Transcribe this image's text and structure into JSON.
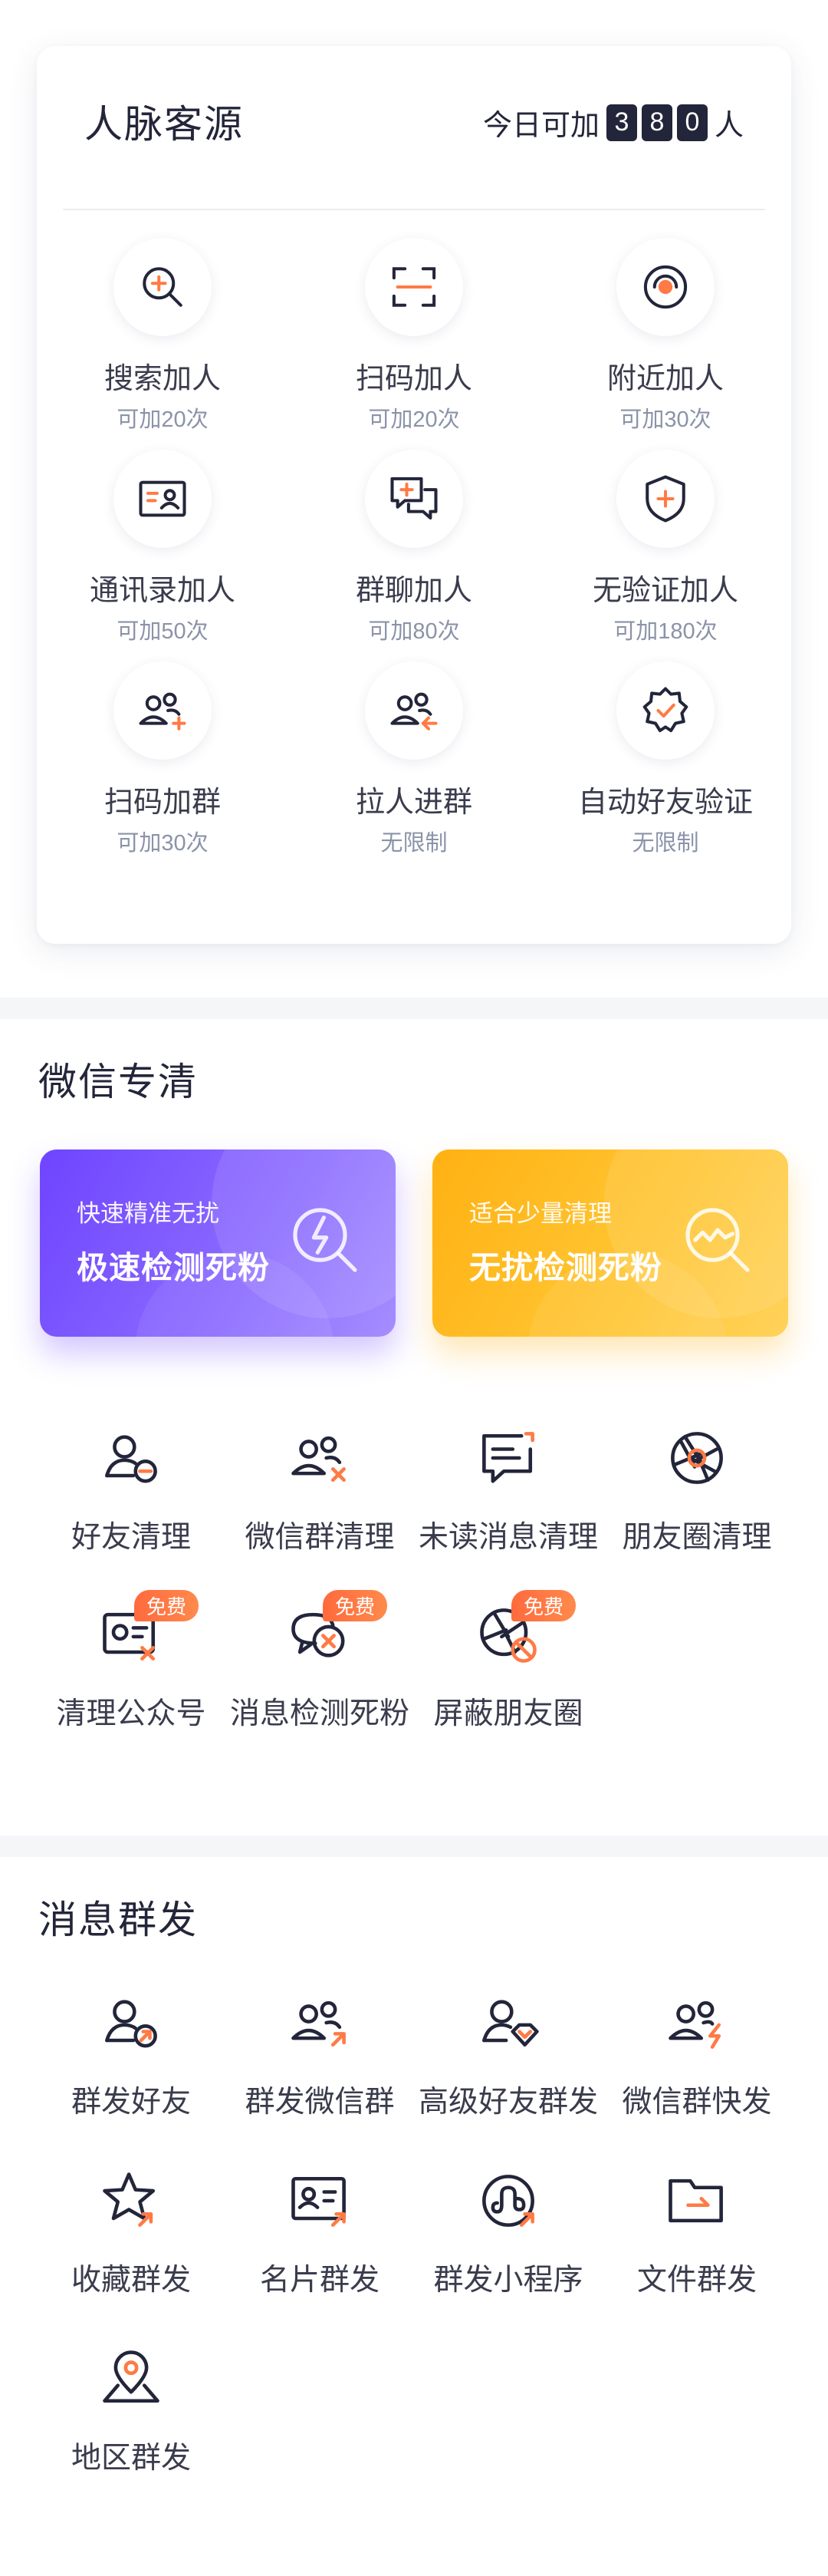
{
  "contacts": {
    "title": "人脉客源",
    "today_prefix": "今日可加",
    "today_digits": [
      "3",
      "8",
      "0"
    ],
    "today_suffix": "人",
    "items": [
      {
        "label": "搜索加人",
        "sub": "可加20次",
        "icon": "search-plus-icon"
      },
      {
        "label": "扫码加人",
        "sub": "可加20次",
        "icon": "scan-icon"
      },
      {
        "label": "附近加人",
        "sub": "可加30次",
        "icon": "nearby-icon"
      },
      {
        "label": "通讯录加人",
        "sub": "可加50次",
        "icon": "contact-card-icon"
      },
      {
        "label": "群聊加人",
        "sub": "可加80次",
        "icon": "group-chat-icon"
      },
      {
        "label": "无验证加人",
        "sub": "可加180次",
        "icon": "shield-plus-icon"
      },
      {
        "label": "扫码加群",
        "sub": "可加30次",
        "icon": "group-add-icon"
      },
      {
        "label": "拉人进群",
        "sub": "无限制",
        "icon": "group-pull-icon"
      },
      {
        "label": "自动好友验证",
        "sub": "无限制",
        "icon": "verified-badge-icon"
      }
    ]
  },
  "cleanup": {
    "title": "微信专清",
    "promo": [
      {
        "top": "快速精准无扰",
        "main": "极速检测死粉",
        "icon": "lightning-search-icon",
        "color": "#7048ff"
      },
      {
        "top": "适合少量清理",
        "main": "无扰检测死粉",
        "icon": "wave-search-icon",
        "color": "#ffb418"
      }
    ],
    "free_badge": "免费",
    "items": [
      {
        "label": "好友清理",
        "icon": "friend-remove-icon"
      },
      {
        "label": "微信群清理",
        "icon": "group-remove-icon"
      },
      {
        "label": "未读消息清理",
        "icon": "unread-message-icon"
      },
      {
        "label": "朋友圈清理",
        "icon": "moments-icon"
      },
      {
        "label": "清理公众号",
        "icon": "official-account-icon"
      },
      {
        "label": "消息检测死粉",
        "icon": "message-check-icon"
      },
      {
        "label": "屏蔽朋友圈",
        "icon": "moments-block-icon"
      }
    ]
  },
  "broadcast": {
    "title": "消息群发",
    "items": [
      {
        "label": "群发好友",
        "icon": "friend-send-icon"
      },
      {
        "label": "群发微信群",
        "icon": "group-send-icon"
      },
      {
        "label": "高级好友群发",
        "icon": "premium-send-icon"
      },
      {
        "label": "微信群快发",
        "icon": "group-fast-send-icon"
      },
      {
        "label": "收藏群发",
        "icon": "star-send-icon"
      },
      {
        "label": "名片群发",
        "icon": "card-send-icon"
      },
      {
        "label": "群发小程序",
        "icon": "mini-program-icon"
      },
      {
        "label": "文件群发",
        "icon": "folder-send-icon"
      },
      {
        "label": "地区群发",
        "icon": "location-send-icon"
      }
    ]
  },
  "colors": {
    "dark": "#23253a",
    "accent": "#ff7a45",
    "muted": "#8a93a8"
  }
}
